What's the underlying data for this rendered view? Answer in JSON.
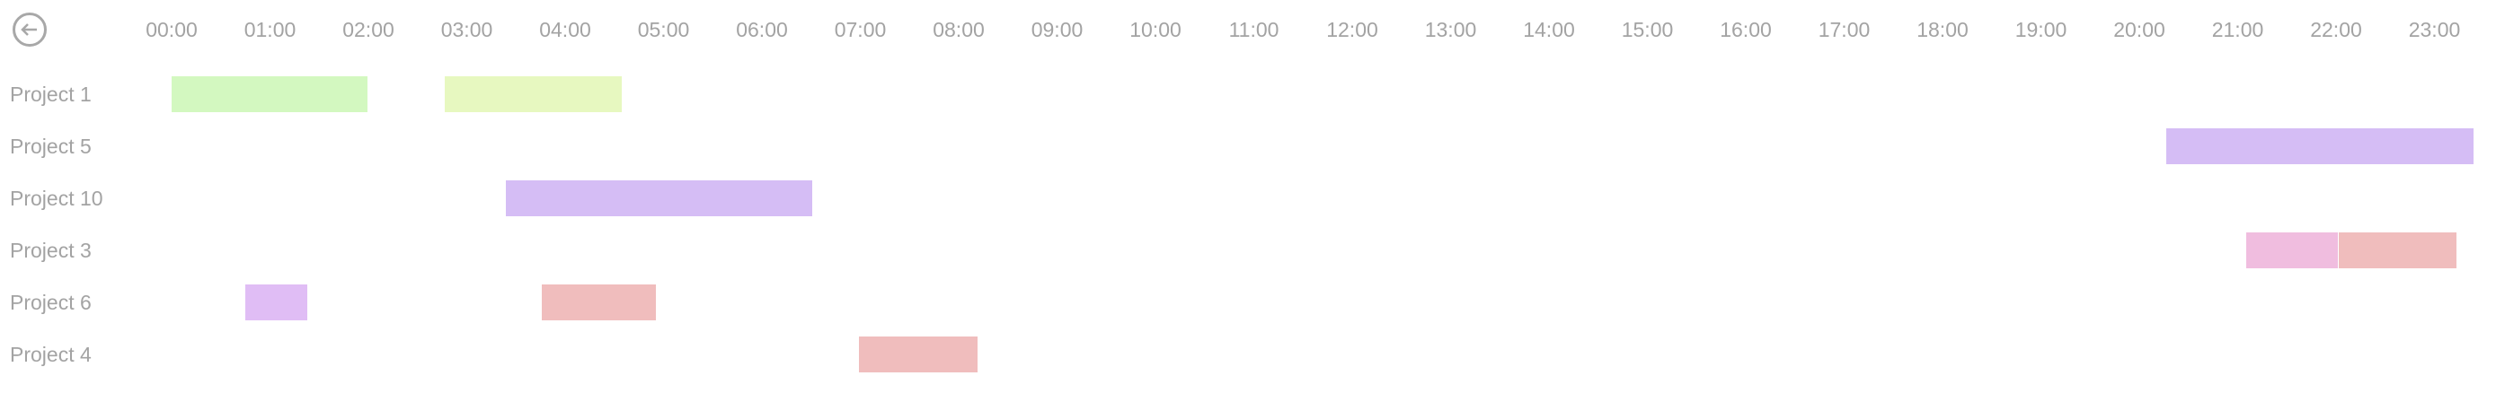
{
  "back_button": {
    "icon": "arrow-left-circle-icon"
  },
  "chart_data": {
    "type": "gantt",
    "x_unit": "hours",
    "xlim": [
      0,
      24
    ],
    "tick_labels": [
      "00:00",
      "01:00",
      "02:00",
      "03:00",
      "04:00",
      "05:00",
      "06:00",
      "07:00",
      "08:00",
      "09:00",
      "10:00",
      "11:00",
      "12:00",
      "13:00",
      "14:00",
      "15:00",
      "16:00",
      "17:00",
      "18:00",
      "19:00",
      "20:00",
      "21:00",
      "22:00",
      "23:00"
    ],
    "rows": [
      {
        "label": "Project 1",
        "bars": [
          {
            "start": 0.0,
            "end": 2.0,
            "color": "#d3f8c0"
          },
          {
            "start": 2.78,
            "end": 4.58,
            "color": "#e7f8c0"
          }
        ]
      },
      {
        "label": "Project 5",
        "bars": [
          {
            "start": 20.27,
            "end": 23.41,
            "color": "#d5bdf5"
          }
        ]
      },
      {
        "label": "Project 10",
        "bars": [
          {
            "start": 3.4,
            "end": 6.52,
            "color": "#d5bdf5"
          }
        ]
      },
      {
        "label": "Project 3",
        "bars": [
          {
            "start": 21.09,
            "end": 22.03,
            "color": "#f0bddf"
          },
          {
            "start": 22.03,
            "end": 23.23,
            "color": "#f0bdbd"
          }
        ]
      },
      {
        "label": "Project 6",
        "bars": [
          {
            "start": 0.75,
            "end": 1.39,
            "color": "#e0bdf5"
          },
          {
            "start": 3.76,
            "end": 4.93,
            "color": "#f0bdbd"
          }
        ]
      },
      {
        "label": "Project 4",
        "bars": [
          {
            "start": 6.99,
            "end": 8.2,
            "color": "#f0bdbd"
          }
        ]
      }
    ]
  }
}
